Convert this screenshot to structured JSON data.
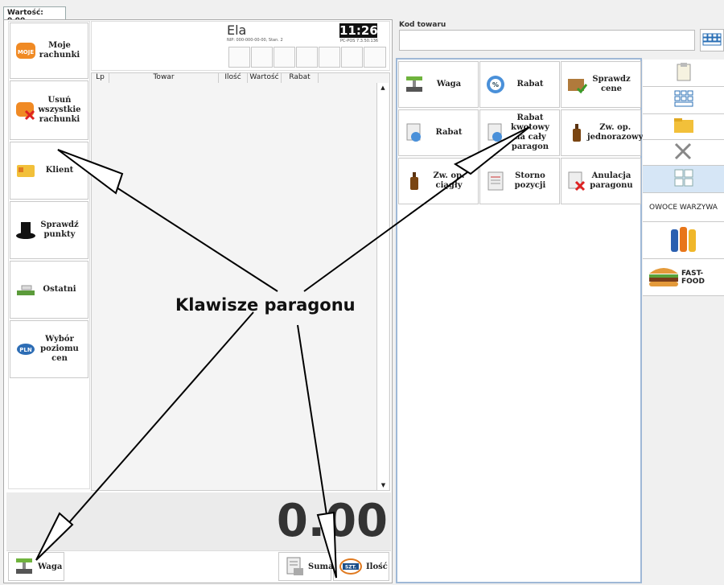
{
  "header": {
    "value_tab": "Wartość: 0.00"
  },
  "left_buttons": [
    {
      "label": "Moje rachunki"
    },
    {
      "label": "Usuń wszystkie rachunki"
    },
    {
      "label": "Klient"
    },
    {
      "label": "Sprawdź punkty"
    },
    {
      "label": "Ostatni"
    },
    {
      "label": "Wybór poziomu cen"
    }
  ],
  "receipt": {
    "cashier": "Ela",
    "time": "11:26",
    "nip_line": "NIP: 000-000-00-00, Stan. 2",
    "version": "PC-POS 7.3.50.136",
    "columns": [
      "Lp",
      "Towar",
      "Ilość",
      "Wartość",
      "Rabat"
    ],
    "total": "0.00"
  },
  "bottom": {
    "weight_label": "Waga",
    "sum_label": "Suma",
    "qty_label": "Ilość",
    "qty_badge": "SZT."
  },
  "product": {
    "code_label": "Kod towaru",
    "code_value": ""
  },
  "grid_buttons": [
    {
      "label": "Waga"
    },
    {
      "label": "Rabat"
    },
    {
      "label": "Sprawdz cene"
    },
    {
      "label": "Rabat"
    },
    {
      "label": "Rabat kwotowy na cały paragon"
    },
    {
      "label": "Zw. op. jednorazowy"
    },
    {
      "label": "Zw. op. ciągły"
    },
    {
      "label": "Storno pozycji"
    },
    {
      "label": "Anulacja paragonu"
    }
  ],
  "side_categories": [
    {
      "label": "OWOCE WARZYWA"
    },
    {
      "label": "FAST-FOOD"
    }
  ],
  "annotation": "Klawisze paragonu",
  "icons": {
    "moje": "moje-rachunki-icon",
    "usun": "usun-rachunki-icon",
    "klient": "klient-icon",
    "punkty": "top-hat-icon",
    "ostatni": "ostatni-icon",
    "ceny": "pln-icon",
    "waga": "scale-icon",
    "rabat": "percent-icon",
    "cena": "box-check-icon",
    "bottle": "bottle-icon",
    "storno": "storno-doc-icon",
    "anul": "cancel-doc-icon"
  }
}
